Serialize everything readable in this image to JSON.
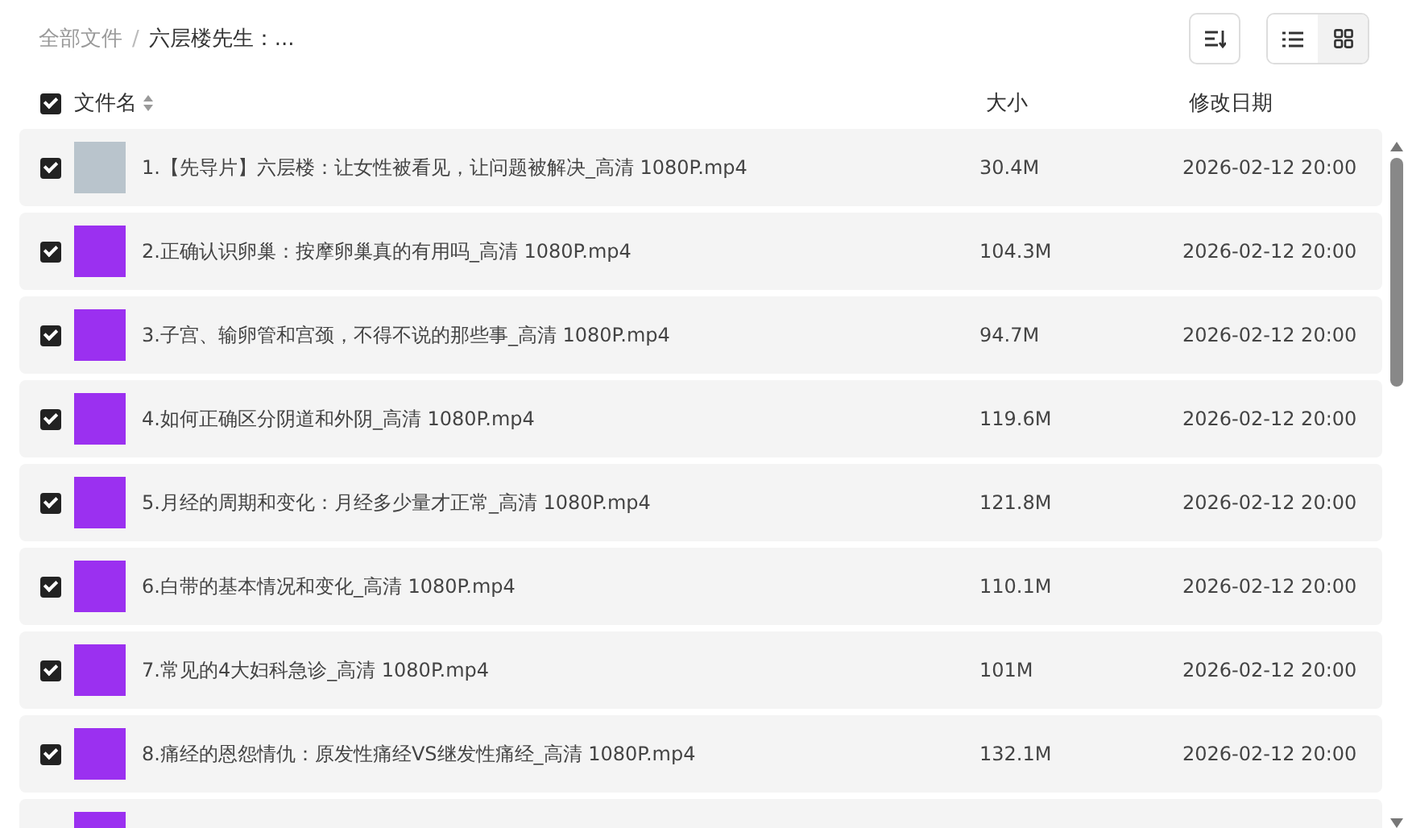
{
  "breadcrumb": [
    {
      "label": "全部文件",
      "current": false
    },
    {
      "label": "六层楼先生：...",
      "current": true
    }
  ],
  "breadcrumb_separator": "/",
  "view_toggle": [
    {
      "kind": "list",
      "selected": true
    },
    {
      "kind": "grid",
      "selected": false
    }
  ],
  "table": {
    "select_all": {
      "checked": true
    },
    "columns": [
      "文件名",
      "大小",
      "修改日期"
    ],
    "rows": [
      {
        "checked": true,
        "name": "1.【先导片】六层楼：让女性被看见，让问题被解决_高清 1080P.mp4",
        "size": "30.4M",
        "modified": "2026-02-12 20:00"
      },
      {
        "checked": true,
        "name": "2.正确认识卵巢：按摩卵巢真的有用吗_高清 1080P.mp4",
        "size": "104.3M",
        "modified": "2026-02-12 20:00"
      },
      {
        "checked": true,
        "name": "3.子宫、输卵管和宫颈，不得不说的那些事_高清 1080P.mp4",
        "size": "94.7M",
        "modified": "2026-02-12 20:00"
      },
      {
        "checked": true,
        "name": "4.如何正确区分阴道和外阴_高清 1080P.mp4",
        "size": "119.6M",
        "modified": "2026-02-12 20:00"
      },
      {
        "checked": true,
        "name": "5.月经的周期和变化：月经多少量才正常_高清 1080P.mp4",
        "size": "121.8M",
        "modified": "2026-02-12 20:00"
      },
      {
        "checked": true,
        "name": "6.白带的基本情况和变化_高清 1080P.mp4",
        "size": "110.1M",
        "modified": "2026-02-12 20:00"
      },
      {
        "checked": true,
        "name": "7.常见的4大妇科急诊_高清 1080P.mp4",
        "size": "101M",
        "modified": "2026-02-12 20:00"
      },
      {
        "checked": true,
        "name": "8.痛经的恩怨情仇：原发性痛经VS继发性痛经_高清 1080P.mp4",
        "size": "132.1M",
        "modified": "2026-02-12 20:00"
      }
    ]
  }
}
